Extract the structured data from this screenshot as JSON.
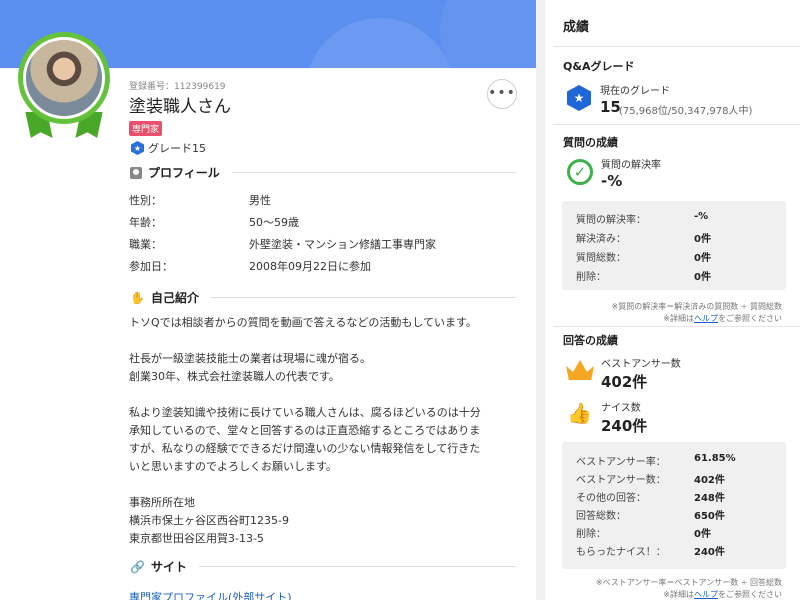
{
  "profile": {
    "reg_number": "登録番号：112399619",
    "name": "塗装職人さん",
    "badge": "専門家",
    "grade": "グレード15",
    "more": "•••"
  },
  "profile_section": {
    "title": "プロフィール",
    "rows": [
      {
        "label": "性別：",
        "value": "男性"
      },
      {
        "label": "年齢：",
        "value": "50～59歳"
      },
      {
        "label": "職業：",
        "value": "外壁塗装・マンション修繕工事専門家"
      },
      {
        "label": "参加日：",
        "value": "2008年09月22日に参加"
      }
    ]
  },
  "intro_section": {
    "title": "自己紹介",
    "lines": [
      "トソQでは相談者からの質問を動画で答えるなどの活動もしています。",
      "",
      "社長が一級塗装技能士の業者は現場に魂が宿る。",
      "創業30年、株式会社塗装職人の代表です。",
      "",
      "私より塗装知識や技術に長けている職人さんは、腐るほどいるのは十分",
      "承知しているので、堂々と回答するのは正直恐縮するところではありま",
      "すが、私なりの経験でできるだけ間違いの少ない情報発信をして行きた",
      "いと思いますのでよろしくお願いします。",
      "",
      "事務所所在地",
      "横浜市保土ヶ谷区西谷町1235-9",
      "東京都世田谷区用賀3-13-5"
    ]
  },
  "site_section": {
    "title": "サイト",
    "link": "専門家プロファイル(外部サイト)"
  },
  "results": {
    "title": "成績",
    "qa_grade": {
      "title": "Q&Aグレード",
      "label": "現在のグレード",
      "value": "15",
      "rank": "(75,968位/50,347,978人中)"
    },
    "question": {
      "title": "質問の成績",
      "label": "質問の解決率",
      "value": "-%",
      "rows": [
        {
          "label": "質問の解決率：",
          "value": "-%"
        },
        {
          "label": "解決済み：",
          "value": "0件"
        },
        {
          "label": "質問総数：",
          "value": "0件"
        },
        {
          "label": "削除：",
          "value": "0件"
        }
      ],
      "note1": "※質問の解決率＝解決済みの質問数 ÷ 質問総数",
      "note2_prefix": "※詳細は",
      "note2_link": "ヘルプ",
      "note2_suffix": "をご参照ください"
    },
    "answer": {
      "title": "回答の成績",
      "best_label": "ベストアンサー数",
      "best_value": "402件",
      "nice_label": "ナイス数",
      "nice_value": "240件",
      "rows": [
        {
          "label": "ベストアンサー率：",
          "value": "61.85%"
        },
        {
          "label": "ベストアンサー数：",
          "value": "402件"
        },
        {
          "label": "その他の回答：",
          "value": "248件"
        },
        {
          "label": "回答総数：",
          "value": "650件"
        },
        {
          "label": "削除：",
          "value": "0件"
        },
        {
          "label": "もらったナイス！：",
          "value": "240件"
        }
      ],
      "note1": "※ベストアンサー率＝ベストアンサー数 ÷ 回答総数",
      "note2_prefix": "※詳細は",
      "note2_link": "ヘルプ",
      "note2_suffix": "をご参照ください"
    }
  }
}
